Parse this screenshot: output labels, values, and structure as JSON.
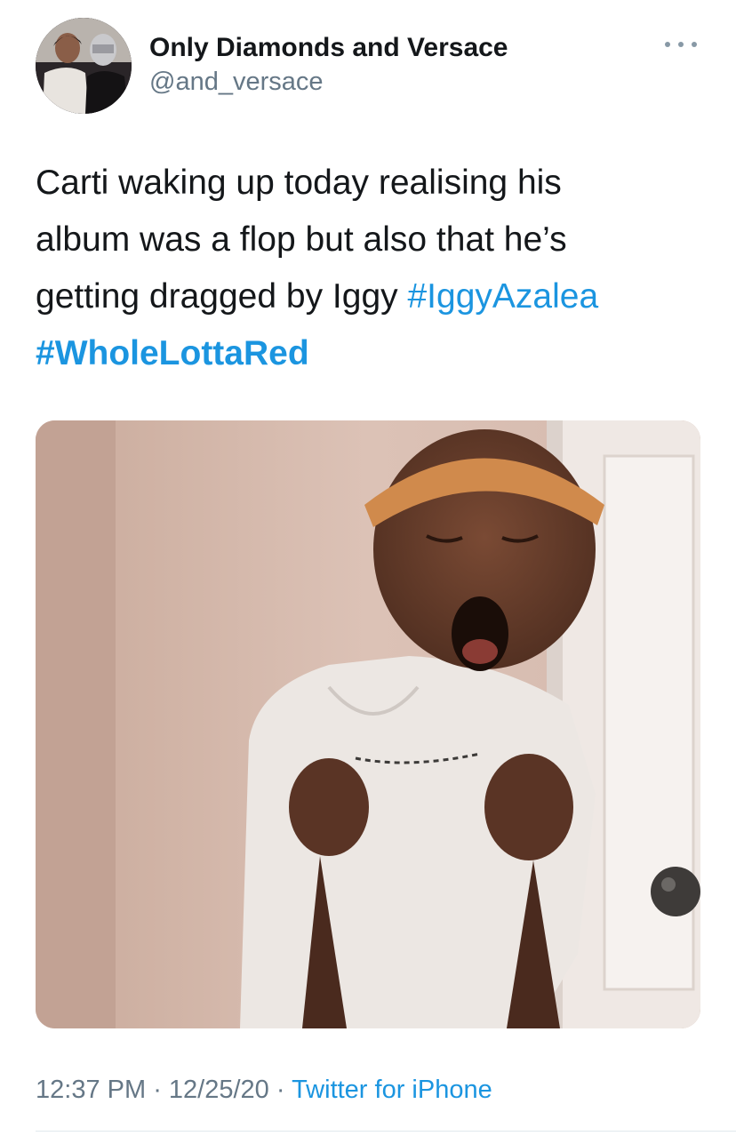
{
  "tweet": {
    "author": {
      "display_name": "Only Diamonds and Versace",
      "handle": "@and_versace"
    },
    "more_icon": "more-horizontal-icon",
    "text": {
      "line1": "Carti waking up today realising his",
      "line2": "album was a flop but also that he’s",
      "line3_plain": "getting dragged by Iggy ",
      "hashtag1": "#IggyAzalea",
      "hashtag2": "#WholeLottaRed"
    },
    "meta": {
      "time": "12:37 PM",
      "separator1": " · ",
      "date": "12/25/20",
      "separator2": " · ",
      "source": "Twitter for iPhone"
    }
  },
  "colors": {
    "link": "#1b95e0",
    "text": "#14171a",
    "secondary": "#657786"
  }
}
